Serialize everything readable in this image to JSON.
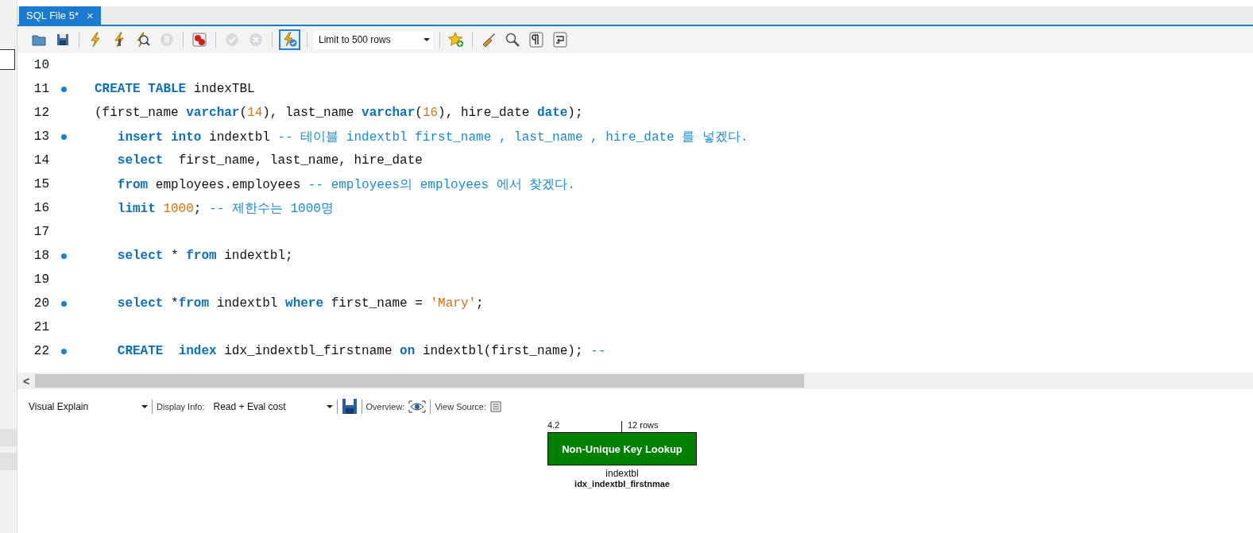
{
  "tab": {
    "title": "SQL File 5*",
    "close": "×",
    "selected": true
  },
  "toolbar": {
    "buttons": [
      {
        "disabled": false,
        "pressed": false
      },
      {
        "disabled": false,
        "pressed": false
      },
      {
        "disabled": false,
        "pressed": false
      },
      {
        "disabled": false,
        "pressed": false
      },
      {
        "disabled": false,
        "pressed": false
      },
      {
        "disabled": true,
        "pressed": false
      },
      {
        "disabled": false,
        "pressed": false
      },
      {
        "disabled": true,
        "pressed": false
      },
      {
        "disabled": true,
        "pressed": false
      },
      {
        "disabled": false,
        "pressed": true
      }
    ],
    "limit": "Limit to 500 rows",
    "tools": [
      {
        "disabled": false
      },
      {
        "disabled": false
      },
      {
        "disabled": false
      },
      {
        "disabled": false
      },
      {
        "disabled": false
      }
    ]
  },
  "editor": {
    "lines": [
      {
        "number": "10",
        "statement": false
      },
      {
        "number": "11",
        "statement": true,
        "tokens": [
          {
            "kind": "kw",
            "text": "CREATE TABLE"
          },
          {
            "kind": "id",
            "text": " indexTBL"
          }
        ]
      },
      {
        "number": "12",
        "statement": false,
        "tokens": [
          {
            "kind": "id",
            "text": "(first_name "
          },
          {
            "kind": "kw",
            "text": "varchar"
          },
          {
            "kind": "id",
            "text": "("
          },
          {
            "kind": "num",
            "text": "14"
          },
          {
            "kind": "id",
            "text": "), last_name "
          },
          {
            "kind": "kw",
            "text": "varchar"
          },
          {
            "kind": "id",
            "text": "("
          },
          {
            "kind": "num",
            "text": "16"
          },
          {
            "kind": "id",
            "text": "), hire_date "
          },
          {
            "kind": "kw",
            "text": "date"
          },
          {
            "kind": "id",
            "text": ");"
          }
        ]
      },
      {
        "number": "13",
        "statement": true,
        "tokens": [
          {
            "kind": "kw",
            "text": "   insert into"
          },
          {
            "kind": "id",
            "text": " indextbl "
          },
          {
            "kind": "cm",
            "text": "-- 테이블 indextbl first_name , last_name , hire_date 를 넣겠다."
          }
        ]
      },
      {
        "number": "14",
        "statement": false,
        "tokens": [
          {
            "kind": "kw",
            "text": "   select"
          },
          {
            "kind": "id",
            "text": "  first_name, last_name, hire_date"
          }
        ]
      },
      {
        "number": "15",
        "statement": false,
        "tokens": [
          {
            "kind": "kw",
            "text": "   from"
          },
          {
            "kind": "id",
            "text": " employees.employees "
          },
          {
            "kind": "cm",
            "text": "-- employees의 employees 에서 찾겠다."
          }
        ]
      },
      {
        "number": "16",
        "statement": false,
        "tokens": [
          {
            "kind": "kw",
            "text": "   limit"
          },
          {
            "kind": "num",
            "text": " 1000"
          },
          {
            "kind": "id",
            "text": "; "
          },
          {
            "kind": "cm",
            "text": "-- 제한수는 1000명"
          }
        ]
      },
      {
        "number": "17",
        "statement": false
      },
      {
        "number": "18",
        "statement": true,
        "tokens": [
          {
            "kind": "kw",
            "text": "   select"
          },
          {
            "kind": "id",
            "text": " * "
          },
          {
            "kind": "kw",
            "text": "from"
          },
          {
            "kind": "id",
            "text": " indextbl;"
          }
        ]
      },
      {
        "number": "19",
        "statement": false
      },
      {
        "number": "20",
        "statement": true,
        "tokens": [
          {
            "kind": "kw",
            "text": "   select"
          },
          {
            "kind": "id",
            "text": " *"
          },
          {
            "kind": "kw",
            "text": "from"
          },
          {
            "kind": "id",
            "text": " indextbl "
          },
          {
            "kind": "kw",
            "text": "where"
          },
          {
            "kind": "id",
            "text": " first_name = "
          },
          {
            "kind": "str",
            "text": "'Mary'"
          },
          {
            "kind": "id",
            "text": ";"
          }
        ]
      },
      {
        "number": "21",
        "statement": false
      },
      {
        "number": "22",
        "statement": true,
        "tokens": [
          {
            "kind": "kw",
            "text": "   CREATE"
          },
          {
            "kind": "kw",
            "text": "  index"
          },
          {
            "kind": "id",
            "text": " idx_indextbl_firstname "
          },
          {
            "kind": "kw",
            "text": "on"
          },
          {
            "kind": "id",
            "text": " indextbl(first_name); "
          },
          {
            "kind": "cm",
            "text": "--"
          }
        ]
      }
    ],
    "scroll_left": "<"
  },
  "explain_bar": {
    "view": "Visual Explain",
    "display_label": "Display Info:",
    "display": "Read + Eval cost",
    "overview_label": "Overview:",
    "source_label": "View Source:"
  },
  "diagram": {
    "cost": "4.2",
    "rows": "12 rows",
    "node": "Non-Unique Key Lookup",
    "table": "indextbl",
    "key": "idx_indextbl_firstnmae"
  }
}
